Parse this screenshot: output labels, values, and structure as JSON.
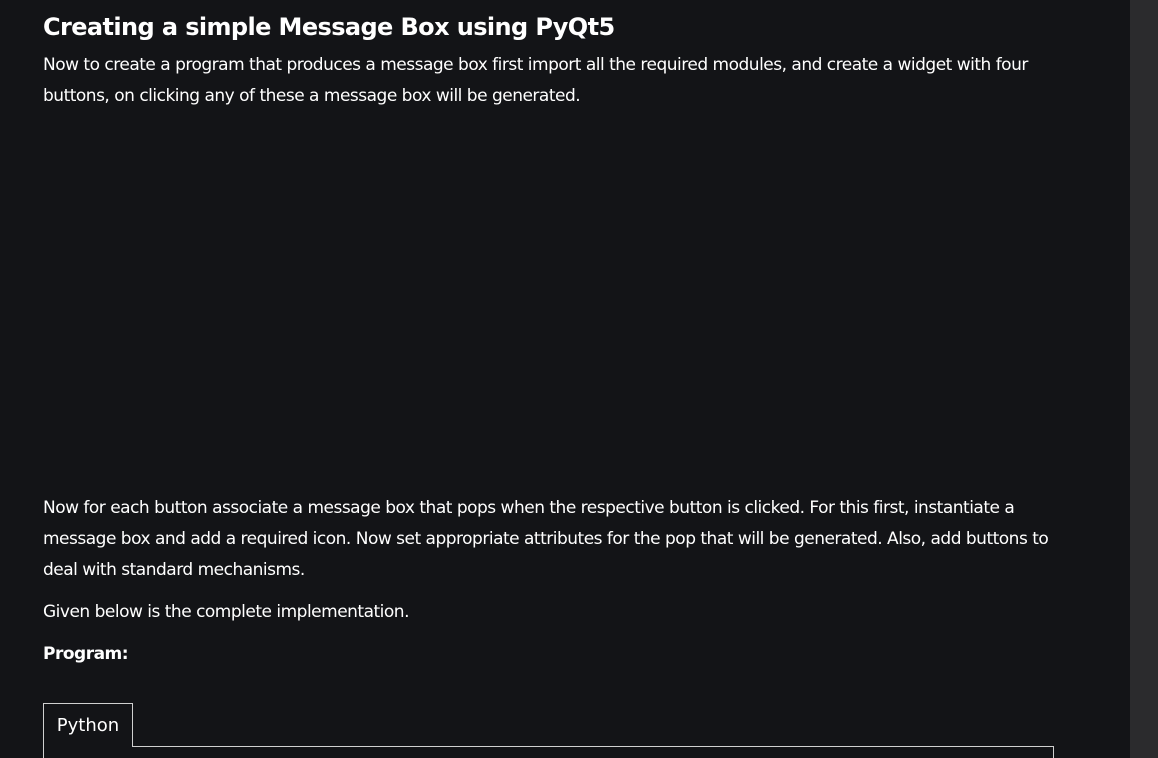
{
  "article": {
    "title": "Creating a simple Message Box using PyQt5",
    "paragraph_1": "Now to create a program that produces a message box first import all the required modules, and create a widget with four buttons, on clicking any of these a message box will be generated.",
    "paragraph_2": "Now for each button associate a message box that pops when the respective button is clicked. For this first, instantiate a message box and add a required icon. Now set appropriate attributes for the pop that will be generated. Also, add buttons to deal with standard mechanisms.",
    "paragraph_3": "Given below is the complete implementation.",
    "program_label": "Program:"
  },
  "code_block": {
    "tabs": [
      {
        "label": "Python"
      }
    ]
  },
  "colors": {
    "background": "#131417",
    "text": "#ffffff",
    "border": "#d0d0d0",
    "scrollbar": "#2b2b2d"
  }
}
